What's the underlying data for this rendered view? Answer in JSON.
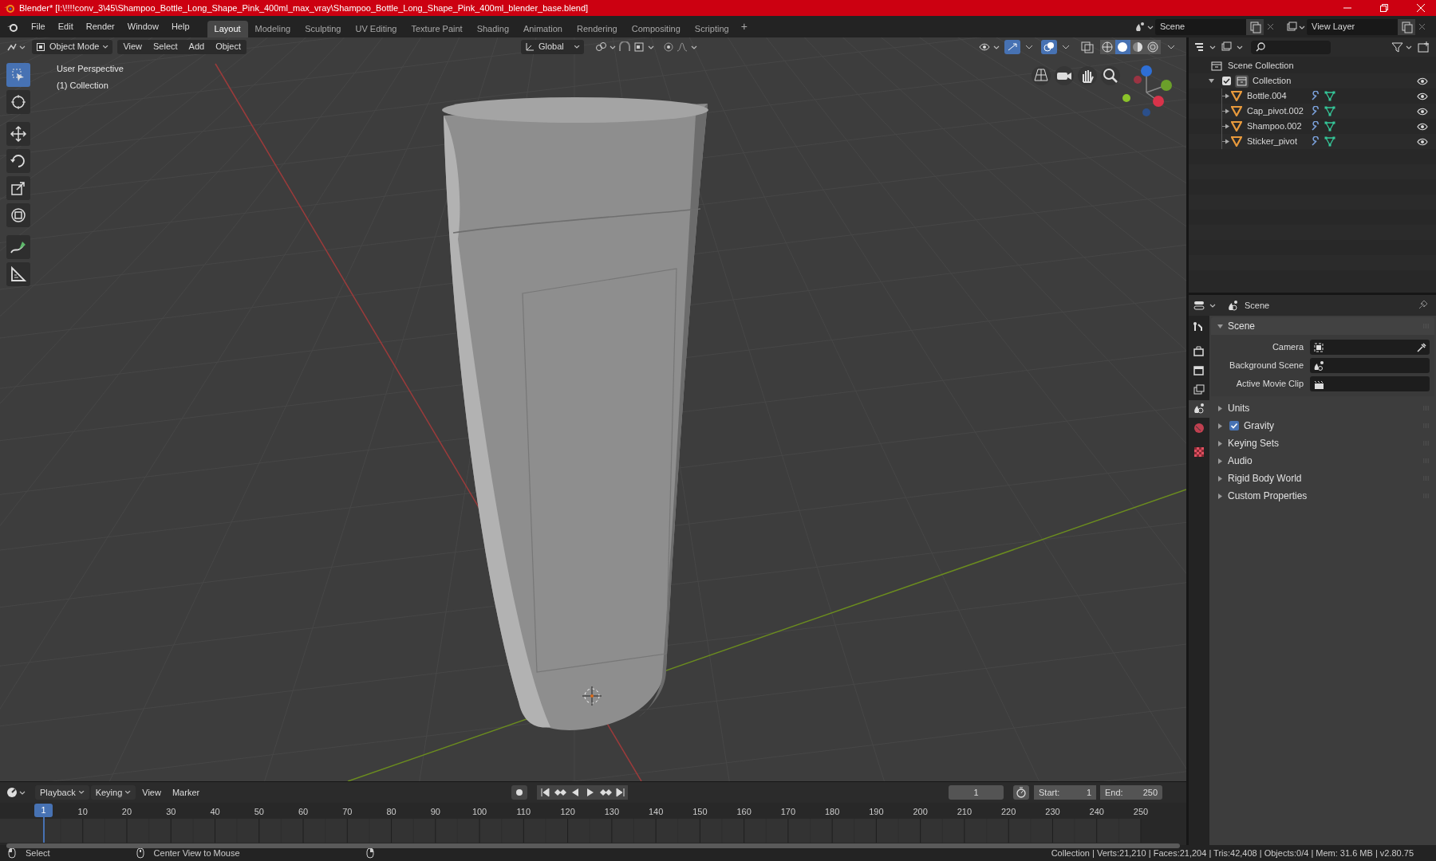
{
  "window": {
    "title": "Blender* [I:\\!!!!conv_3\\45\\Shampoo_Bottle_Long_Shape_Pink_400ml_max_vray\\Shampoo_Bottle_Long_Shape_Pink_400ml_blender_base.blend]"
  },
  "menu": [
    "File",
    "Edit",
    "Render",
    "Window",
    "Help"
  ],
  "workspaces": [
    {
      "label": "Layout",
      "selected": true
    },
    {
      "label": "Modeling",
      "selected": false
    },
    {
      "label": "Sculpting",
      "selected": false
    },
    {
      "label": "UV Editing",
      "selected": false
    },
    {
      "label": "Texture Paint",
      "selected": false
    },
    {
      "label": "Shading",
      "selected": false
    },
    {
      "label": "Animation",
      "selected": false
    },
    {
      "label": "Rendering",
      "selected": false
    },
    {
      "label": "Compositing",
      "selected": false
    },
    {
      "label": "Scripting",
      "selected": false
    }
  ],
  "add_workspace": "+",
  "scene": "Scene",
  "view_layer": "View Layer",
  "viewport": {
    "mode": "Object Mode",
    "menus": [
      "View",
      "Select",
      "Add",
      "Object"
    ],
    "orientation": "Global",
    "shading_modes": [
      {
        "kind": "wireframe",
        "selected": false
      },
      {
        "kind": "solid",
        "selected": true
      },
      {
        "kind": "material",
        "selected": false
      },
      {
        "kind": "rendered",
        "selected": false
      }
    ],
    "tools": [
      {
        "kind": "select",
        "selected": true
      },
      {
        "kind": "cursor",
        "selected": false
      },
      {
        "kind": "move",
        "selected": false
      },
      {
        "kind": "rotate",
        "selected": false
      },
      {
        "kind": "scale",
        "selected": false
      },
      {
        "kind": "transform",
        "selected": false
      },
      {
        "kind": "annotate",
        "selected": false
      },
      {
        "kind": "measure",
        "selected": false
      }
    ],
    "view_name": "User Perspective",
    "collection_label": "(1) Collection"
  },
  "outliner": {
    "root": "Scene Collection",
    "children": [
      {
        "label": "Collection",
        "checked": true,
        "expanded": true,
        "children": [
          {
            "label": "Bottle.004",
            "expanded": false
          },
          {
            "label": "Cap_pivot.002",
            "expanded": false
          },
          {
            "label": "Shampoo.002",
            "expanded": false
          },
          {
            "label": "Sticker_pivot",
            "expanded": false
          }
        ]
      }
    ]
  },
  "properties": {
    "context": "Scene",
    "tabs": [
      {
        "kind": "tool",
        "selected": false
      },
      {
        "kind": "render",
        "selected": false
      },
      {
        "kind": "output",
        "selected": false
      },
      {
        "kind": "view_layer",
        "selected": false
      },
      {
        "kind": "scene",
        "selected": true
      },
      {
        "kind": "world",
        "selected": false
      },
      {
        "kind": "texture",
        "selected": false
      }
    ],
    "panels": [
      {
        "label": "Scene",
        "expanded": true,
        "fields": [
          {
            "label": "Camera",
            "kind": "camera"
          },
          {
            "label": "Background Scene",
            "kind": "scene"
          },
          {
            "label": "Active Movie Clip",
            "kind": "clip"
          }
        ]
      },
      {
        "label": "Units",
        "expanded": false
      },
      {
        "label": "Gravity",
        "expanded": false,
        "checked": true
      },
      {
        "label": "Keying Sets",
        "expanded": false
      },
      {
        "label": "Audio",
        "expanded": false
      },
      {
        "label": "Rigid Body World",
        "expanded": false
      },
      {
        "label": "Custom Properties",
        "expanded": false
      }
    ]
  },
  "timeline": {
    "menus": [
      {
        "label": "Playback",
        "dropdown": true
      },
      {
        "label": "Keying",
        "dropdown": true
      },
      {
        "label": "View",
        "dropdown": false
      },
      {
        "label": "Marker",
        "dropdown": false
      }
    ],
    "current_frame": "1",
    "start_label": "Start:",
    "start": "1",
    "end_label": "End:",
    "end": "250",
    "ruler": [
      "10",
      "20",
      "30",
      "40",
      "50",
      "60",
      "70",
      "80",
      "90",
      "100",
      "110",
      "120",
      "130",
      "140",
      "150",
      "160",
      "170",
      "180",
      "190",
      "200",
      "210",
      "220",
      "230",
      "240",
      "250"
    ],
    "playhead": "1"
  },
  "status_bar": {
    "hints": [
      "Select",
      "Center View to Mouse"
    ],
    "stats": "Collection | Verts:21,210 | Faces:21,204 | Tris:42,408 | Objects:0/4 | Mem: 31.6 MB | v2.80.75"
  }
}
